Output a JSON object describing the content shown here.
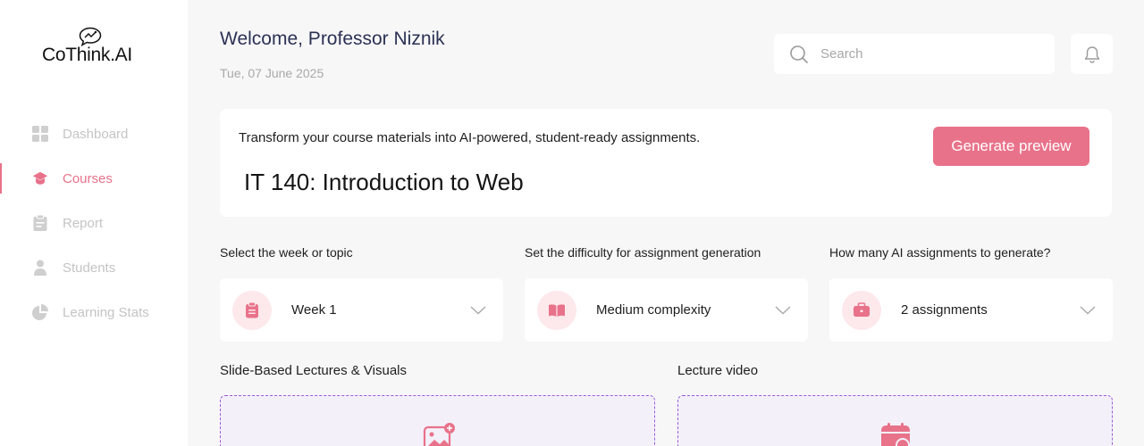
{
  "brand": {
    "name": "CoThink.AI"
  },
  "sidebar": {
    "items": [
      {
        "label": "Dashboard",
        "icon": "dashboard-grid-icon",
        "active": false
      },
      {
        "label": "Courses",
        "icon": "graduation-cap-icon",
        "active": true
      },
      {
        "label": "Report",
        "icon": "clipboard-icon",
        "active": false
      },
      {
        "label": "Students",
        "icon": "user-icon",
        "active": false
      },
      {
        "label": "Learning Stats",
        "icon": "pie-chart-icon",
        "active": false
      }
    ]
  },
  "header": {
    "welcome": "Welcome, Professor Niznik",
    "date": "Tue, 07 June 2025",
    "search_placeholder": "Search"
  },
  "hero": {
    "tagline": "Transform your course materials into AI-powered, student-ready assignments.",
    "course_title": "IT 140: Introduction to Web",
    "generate_label": "Generate preview"
  },
  "fields": {
    "week": {
      "label": "Select the week or topic",
      "value": "Week 1"
    },
    "difficulty": {
      "label": "Set the difficulty for assignment generation",
      "value": "Medium complexity"
    },
    "count": {
      "label": "How many AI assignments to generate?",
      "value": "2 assignments"
    }
  },
  "uploads": {
    "slides": {
      "label": "Slide-Based Lectures & Visuals"
    },
    "video": {
      "label": "Lecture video"
    }
  },
  "colors": {
    "accent": "#e8728a",
    "accent_soft": "#fde8ec",
    "dropzone_border": "#9b5ad8",
    "dropzone_bg": "#f3f0fa"
  }
}
